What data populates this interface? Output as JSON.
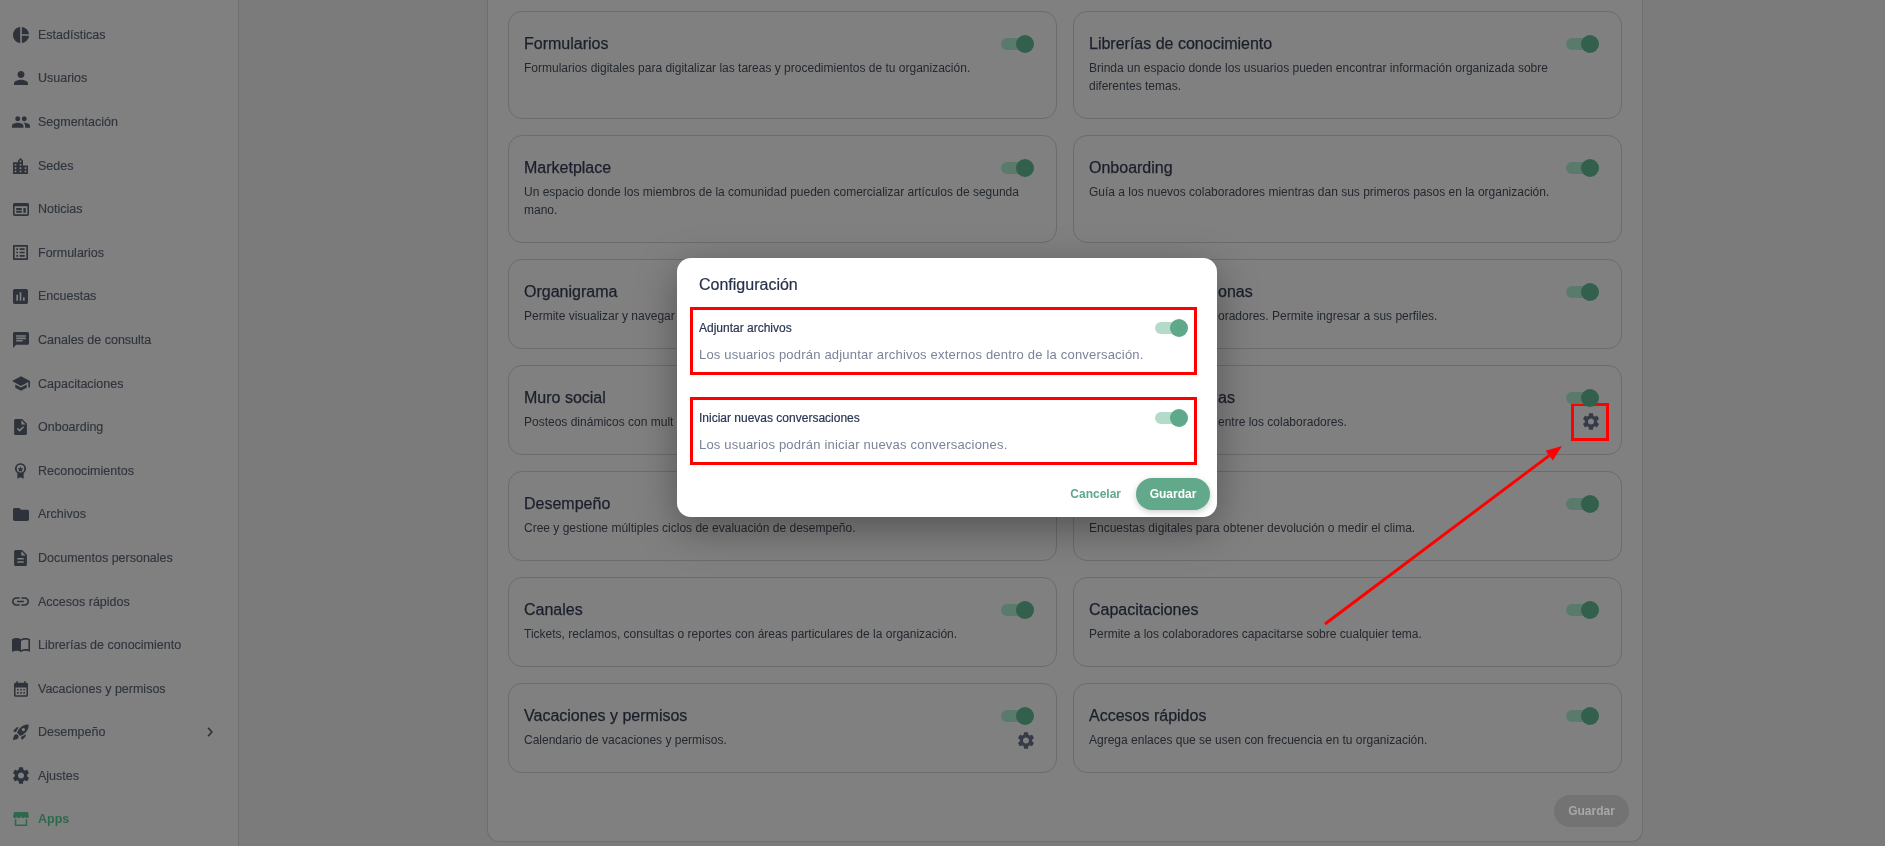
{
  "sidebar": {
    "items": [
      {
        "label": "Estadísticas",
        "selected": false
      },
      {
        "label": "Usuarios",
        "selected": false
      },
      {
        "label": "Segmentación",
        "selected": false
      },
      {
        "label": "Sedes",
        "selected": false
      },
      {
        "label": "Noticias",
        "selected": false
      },
      {
        "label": "Formularios",
        "selected": false
      },
      {
        "label": "Encuestas",
        "selected": false
      },
      {
        "label": "Canales de consulta",
        "selected": false
      },
      {
        "label": "Capacitaciones",
        "selected": false
      },
      {
        "label": "Onboarding",
        "selected": false
      },
      {
        "label": "Reconocimientos",
        "selected": false
      },
      {
        "label": "Archivos",
        "selected": false
      },
      {
        "label": "Documentos personales",
        "selected": false
      },
      {
        "label": "Accesos rápidos",
        "selected": false
      },
      {
        "label": "Librerías de conocimiento",
        "selected": false
      },
      {
        "label": "Vacaciones y permisos",
        "selected": false
      },
      {
        "label": "Desempeño",
        "selected": false,
        "expanded": false
      },
      {
        "label": "Ajustes",
        "selected": false
      },
      {
        "label": "Apps",
        "selected": true
      }
    ]
  },
  "apps": {
    "cards": [
      {
        "kind": "full",
        "title": "Formularios",
        "description": "Formularios digitales para digitalizar las tareas y procedimientos de tu organización.",
        "enabled": true
      },
      {
        "kind": "full",
        "title": "Librerías de conocimiento",
        "description": "Brinda un espacio donde los usuarios pueden encontrar información organizada sobre diferentes temas.",
        "enabled": true
      },
      {
        "kind": "full",
        "title": "Marketplace",
        "description": "Un espacio donde los miembros de la comunidad pueden comercializar artículos de segunda mano.",
        "enabled": true
      },
      {
        "kind": "full",
        "title": "Onboarding",
        "description": "Guía a los nuevos colaboradores mientras dan sus primeros pasos en la organización.",
        "enabled": true
      },
      {
        "kind": "full",
        "title": "Organigrama",
        "description": "Permite visualizar y navegar"
      },
      {
        "kind": "covered",
        "title": "onas",
        "description": "oradores. Permite ingresar a sus perfiles.",
        "enabled": true
      },
      {
        "kind": "full",
        "title": "Muro social",
        "description": "Posteos dinámicos con mult"
      },
      {
        "kind": "covered",
        "title": "as",
        "description": "entre los colaboradores.",
        "enabled": true,
        "settings": {
          "annotated": true
        }
      },
      {
        "kind": "full",
        "title": "Desempeño",
        "description": "Cree y gestione múltiples ciclos de evaluación de desempeño."
      },
      {
        "kind": "full",
        "description": "Encuestas digitales para obtener devolución o medir el clima.",
        "enabled": true
      },
      {
        "kind": "full",
        "title": "Canales",
        "description": "Tickets, reclamos, consultas o reportes con áreas particulares de la organización.",
        "enabled": true
      },
      {
        "kind": "full",
        "title": "Capacitaciones",
        "description": "Permite a los colaboradores capacitarse sobre cualquier tema.",
        "enabled": true
      },
      {
        "kind": "full",
        "title": "Vacaciones y permisos",
        "description": "Calendario de vacaciones y permisos.",
        "enabled": true,
        "settings": {
          "annotated": false
        }
      },
      {
        "kind": "full",
        "title": "Accesos rápidos",
        "description": "Agrega enlaces que se usen con frecuencia en tu organización.",
        "enabled": true
      }
    ],
    "save_button": {
      "label": "Guardar",
      "disabled": true
    }
  },
  "dialog": {
    "title": "Configuración",
    "settings": [
      {
        "label": "Adjuntar archivos",
        "description": "Los usuarios podrán adjuntar archivos externos dentro de la conversación.",
        "enabled": true,
        "annotated": true
      },
      {
        "label": "Iniciar nuevas conversaciones",
        "description": "Los usuarios podrán iniciar nuevas conversaciones.",
        "enabled": true,
        "annotated": true
      }
    ],
    "buttons": [
      {
        "label": "Cancelar",
        "kind": "secondary"
      },
      {
        "label": "Guardar",
        "kind": "primary"
      }
    ]
  }
}
